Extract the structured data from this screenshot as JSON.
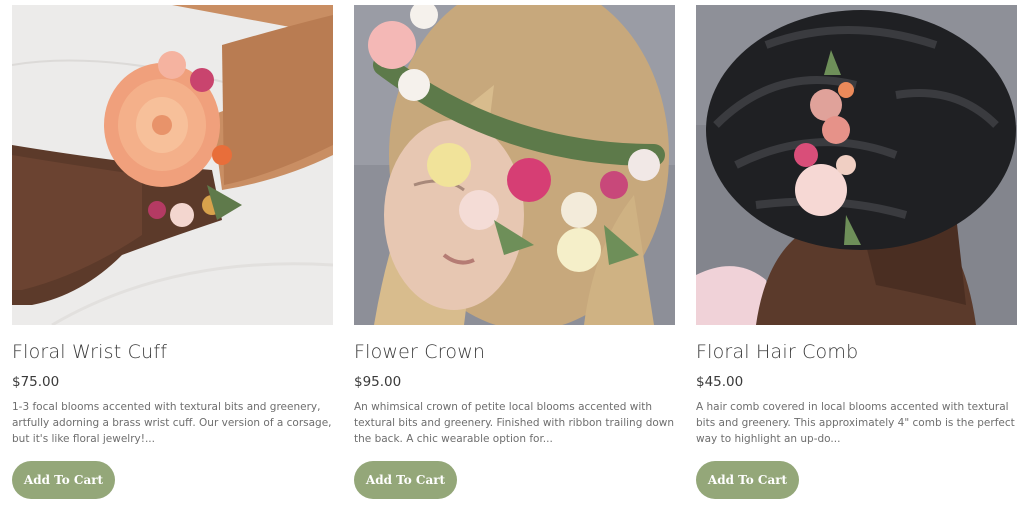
{
  "products": [
    {
      "name": "Floral Wrist Cuff",
      "price": "$75.00",
      "description": "1-3 focal blooms accented with textural bits and greenery, artfully adorning a brass wrist cuff. Our version of a corsage, but it's like floral jewelry!...",
      "button_label": "Add To Cart"
    },
    {
      "name": "Flower Crown",
      "price": "$95.00",
      "description": "An whimsical crown of petite local blooms accented with textural bits and greenery. Finished with ribbon trailing down the back. A chic wearable option for...",
      "button_label": "Add To Cart"
    },
    {
      "name": "Floral Hair Comb",
      "price": "$45.00",
      "description": "A hair comb covered in local blooms accented with textural bits and greenery. This approximately 4\" comb is the perfect way to highlight an up-do...",
      "button_label": "Add To Cart"
    }
  ],
  "colors": {
    "button": "#94a779",
    "title": "#3a3a3a",
    "description": "#6e6e6e"
  }
}
